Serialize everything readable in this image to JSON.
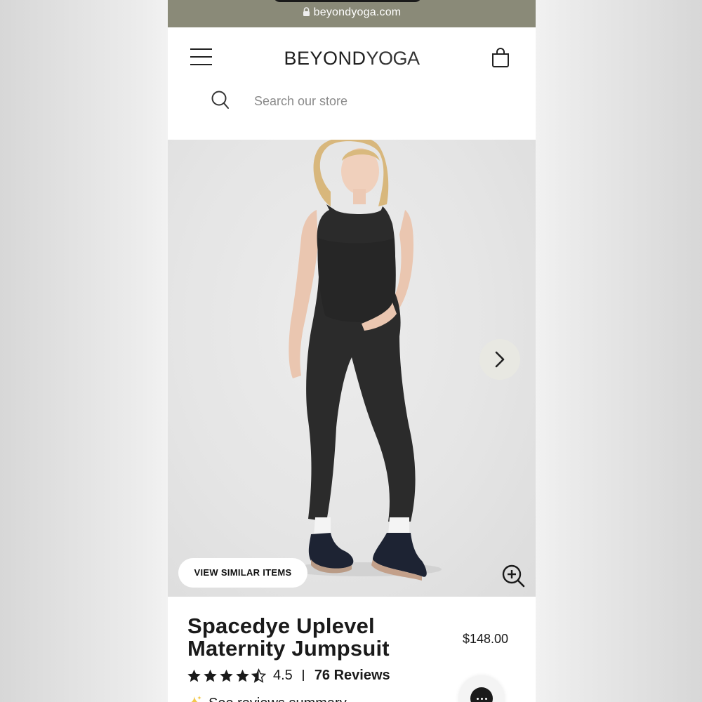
{
  "browser": {
    "url": "beyondyoga.com",
    "icons": [
      "lock-icon"
    ]
  },
  "header": {
    "logo_bold": "BEYOND",
    "logo_light": "YOGA",
    "icons": [
      "menu-icon",
      "shopping-bag-icon"
    ]
  },
  "search": {
    "placeholder": "Search our store",
    "value": "",
    "icon": "search-icon"
  },
  "gallery": {
    "similar_label": "VIEW SIMILAR ITEMS",
    "icons": [
      "chevron-right-icon",
      "zoom-in-icon"
    ]
  },
  "product": {
    "title": "Spacedye Uplevel Maternity Jumpsuit",
    "price": "$148.00",
    "rating": "4.5",
    "rating_value": 4.5,
    "rating_max": 5,
    "reviews": "76 Reviews",
    "summary_label": "See reviews summary"
  },
  "colors": {
    "browser_bar": "#8a8a78",
    "text": "#1a1a1a",
    "sparkle": "#f2c94c",
    "hero_bg": "#e5e5e5"
  }
}
